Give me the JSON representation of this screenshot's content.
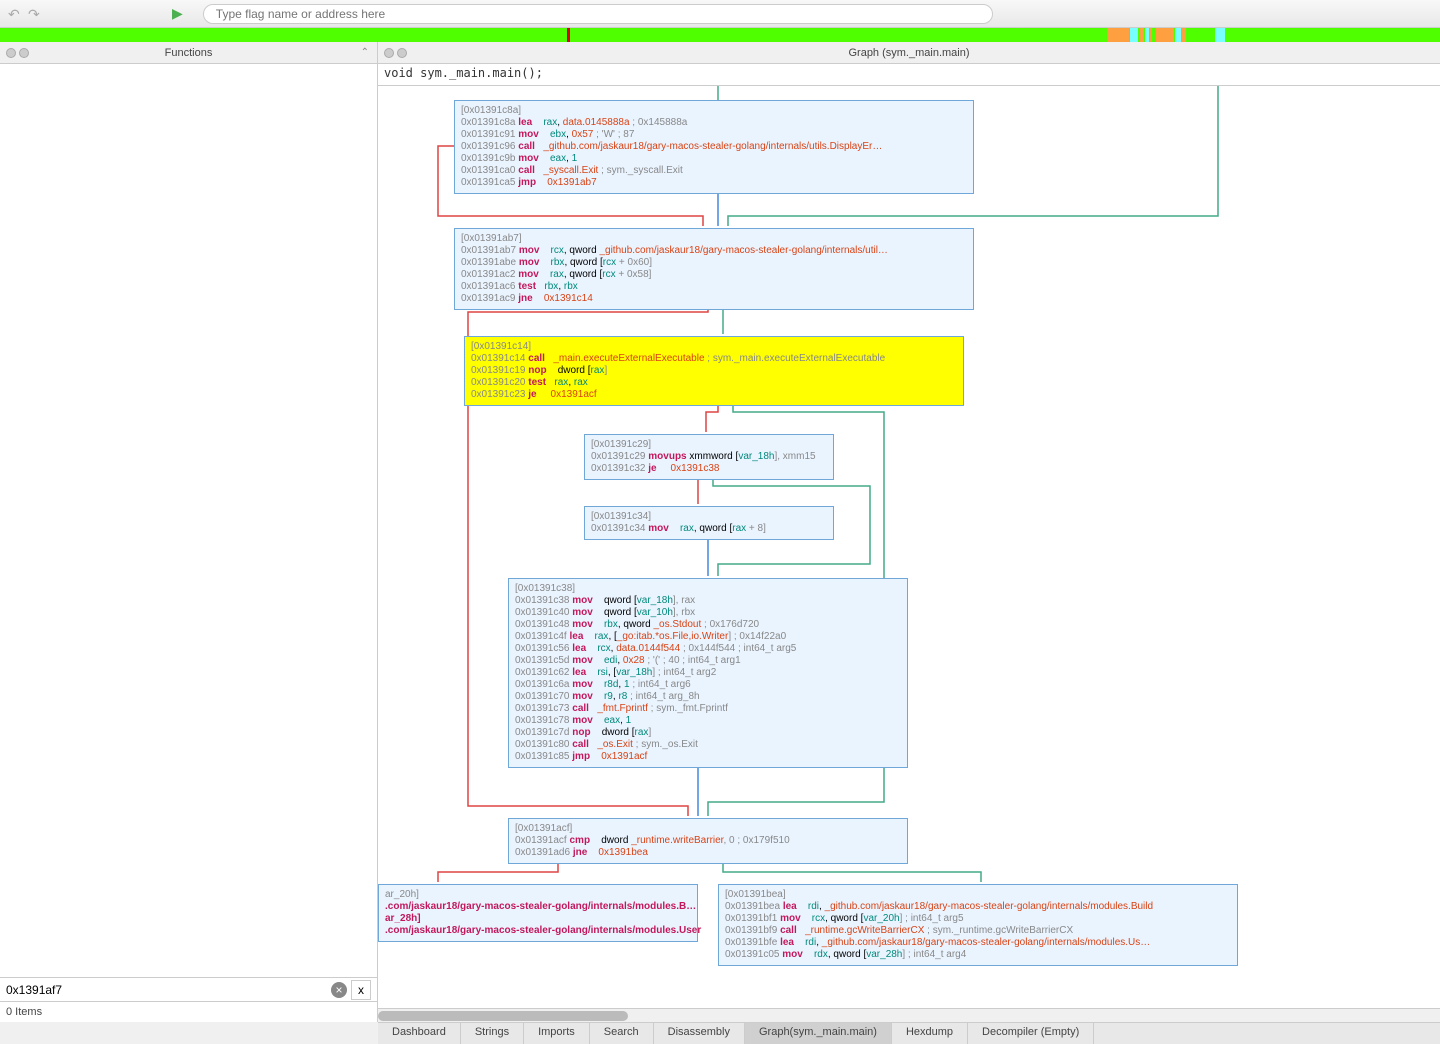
{
  "toolbar": {
    "placeholder": "Type flag name or address here"
  },
  "left": {
    "title": "Functions",
    "filter_value": "0x1391af7",
    "items": "0 Items"
  },
  "right": {
    "title": "Graph (sym._main.main)",
    "signature": "void sym._main.main();"
  },
  "tabs": [
    "Dashboard",
    "Strings",
    "Imports",
    "Search",
    "Disassembly",
    "Graph(sym._main.main)",
    "Hexdump",
    "Decompiler (Empty)"
  ],
  "active_tab": 5,
  "blocks": {
    "b1": {
      "hdr": "[0x01391c8a]",
      "rows": [
        [
          "0x01391c8a",
          "lea",
          "rax",
          ", ",
          "data.0145888a",
          " ; 0x145888a"
        ],
        [
          "0x01391c91",
          "mov",
          "ebx",
          ", ",
          "0x57",
          " ; 'W' ; 87"
        ],
        [
          "0x01391c96",
          "call",
          "",
          "",
          "_github.com/jaskaur18/gary-macos-stealer-golang/internals/utils.DisplayEr…",
          ""
        ],
        [
          "0x01391c9b",
          "mov",
          "eax",
          ", ",
          "1",
          ""
        ],
        [
          "0x01391ca0",
          "call",
          "",
          "",
          "_syscall.Exit",
          " ; sym._syscall.Exit"
        ],
        [
          "0x01391ca5",
          "jmp",
          "",
          "",
          "0x1391ab7",
          ""
        ]
      ]
    },
    "b2": {
      "hdr": "[0x01391ab7]",
      "rows": [
        [
          "0x01391ab7",
          "mov",
          "rcx",
          ", qword ",
          "_github.com/jaskaur18/gary-macos-stealer-golang/internals/util…",
          ""
        ],
        [
          "0x01391abe",
          "mov",
          "rbx",
          ", qword [",
          "rcx",
          " + 0x60]"
        ],
        [
          "0x01391ac2",
          "mov",
          "rax",
          ", qword [",
          "rcx",
          " + 0x58]"
        ],
        [
          "0x01391ac6",
          "test",
          "rbx",
          ", ",
          "rbx",
          ""
        ],
        [
          "0x01391ac9",
          "jne",
          "",
          "",
          "0x1391c14",
          ""
        ]
      ]
    },
    "b3": {
      "hdr": "[0x01391c14]",
      "rows": [
        [
          "0x01391c14",
          "call",
          "",
          "",
          "_main.executeExternalExecutable",
          " ; sym._main.executeExternalExecutable"
        ],
        [
          "0x01391c19",
          "nop",
          "",
          "dword [",
          "rax",
          "]"
        ],
        [
          "0x01391c20",
          "test",
          "rax",
          ", ",
          "rax",
          ""
        ],
        [
          "0x01391c23",
          "je",
          "",
          "",
          "0x1391acf",
          ""
        ]
      ]
    },
    "b4": {
      "hdr": "[0x01391c29]",
      "rows": [
        [
          "0x01391c29",
          "movups",
          "",
          "xmmword [",
          "var_18h",
          "], xmm15"
        ],
        [
          "0x01391c32",
          "je",
          "",
          "",
          "0x1391c38",
          ""
        ]
      ]
    },
    "b5": {
      "hdr": "[0x01391c34]",
      "rows": [
        [
          "0x01391c34",
          "mov",
          "rax",
          ", qword [",
          "rax",
          " + 8]"
        ]
      ]
    },
    "b6": {
      "hdr": "[0x01391c38]",
      "rows": [
        [
          "0x01391c38",
          "mov",
          "",
          "qword [",
          "var_18h",
          "], rax"
        ],
        [
          "0x01391c40",
          "mov",
          "",
          "qword [",
          "var_10h",
          "], rbx"
        ],
        [
          "0x01391c48",
          "mov",
          "rbx",
          ", qword ",
          "_os.Stdout",
          " ; 0x176d720"
        ],
        [
          "0x01391c4f",
          "lea",
          "rax",
          ", [",
          "_go:itab.*os.File,io.Writer",
          "] ; 0x14f22a0"
        ],
        [
          "0x01391c56",
          "lea",
          "rcx",
          ", ",
          "data.0144f544",
          " ; 0x144f544 ; int64_t arg5"
        ],
        [
          "0x01391c5d",
          "mov",
          "edi",
          ", ",
          "0x28",
          " ; '(' ; 40 ; int64_t arg1"
        ],
        [
          "0x01391c62",
          "lea",
          "rsi",
          ", [",
          "var_18h",
          "] ; int64_t arg2"
        ],
        [
          "0x01391c6a",
          "mov",
          "r8d",
          ", ",
          "1",
          "    ; int64_t arg6"
        ],
        [
          "0x01391c70",
          "mov",
          "r9",
          ", ",
          "r8",
          "    ; int64_t arg_8h"
        ],
        [
          "0x01391c73",
          "call",
          "",
          "",
          "_fmt.Fprintf",
          " ; sym._fmt.Fprintf"
        ],
        [
          "0x01391c78",
          "mov",
          "eax",
          ", ",
          "1",
          ""
        ],
        [
          "0x01391c7d",
          "nop",
          "",
          "dword [",
          "rax",
          "]"
        ],
        [
          "0x01391c80",
          "call",
          "",
          "",
          "_os.Exit",
          " ; sym._os.Exit"
        ],
        [
          "0x01391c85",
          "jmp",
          "",
          "",
          "0x1391acf",
          ""
        ]
      ]
    },
    "b7": {
      "hdr": "[0x01391acf]",
      "rows": [
        [
          "0x01391acf",
          "cmp",
          "",
          "dword ",
          "_runtime.writeBarrier",
          ", 0 ; 0x179f510"
        ],
        [
          "0x01391ad6",
          "jne",
          "",
          "",
          "0x1391bea",
          ""
        ]
      ]
    },
    "b8": {
      "hdr": "ar_20h]",
      "rows": [
        [
          "",
          ".com/jaskaur18/gary-macos-stealer-golang/internals/modules.B…",
          "",
          "",
          "",
          ""
        ],
        [
          "",
          "ar_28h]",
          "",
          "",
          "",
          ""
        ],
        [
          "",
          ".com/jaskaur18/gary-macos-stealer-golang/internals/modules.User",
          "",
          "",
          "",
          ""
        ]
      ]
    },
    "b9": {
      "hdr": "[0x01391bea]",
      "rows": [
        [
          "0x01391bea",
          "lea",
          "rdi",
          ", ",
          "_github.com/jaskaur18/gary-macos-stealer-golang/internals/modules.Build",
          ""
        ],
        [
          "0x01391bf1",
          "mov",
          "rcx",
          ", qword [",
          "var_20h",
          "] ; int64_t arg5"
        ],
        [
          "0x01391bf9",
          "call",
          "",
          "",
          "_runtime.gcWriteBarrierCX",
          " ; sym._runtime.gcWriteBarrierCX"
        ],
        [
          "0x01391bfe",
          "lea",
          "rdi",
          ", ",
          "_github.com/jaskaur18/gary-macos-stealer-golang/internals/modules.Us…",
          ""
        ],
        [
          "0x01391c05",
          "mov",
          "rdx",
          ", qword [",
          "var_28h",
          "] ; int64_t arg4"
        ]
      ]
    }
  }
}
